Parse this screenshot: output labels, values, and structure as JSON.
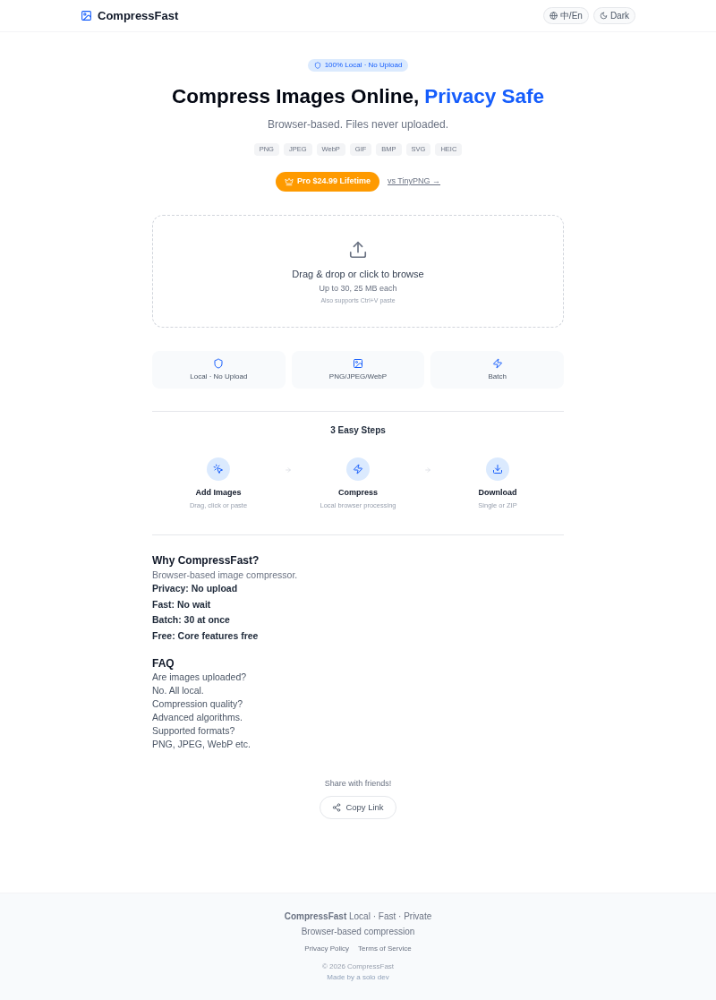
{
  "header": {
    "logo_text": "CompressFast",
    "buttons": [
      {
        "kind": "language",
        "label": "中/En"
      },
      {
        "kind": "theme",
        "label": "Dark"
      }
    ]
  },
  "hero": {
    "badge": "100% Local · No Upload",
    "title": "Compress Images Online,",
    "title_highlight": "Privacy Safe",
    "subtitle": "Browser-based. Files never uploaded.",
    "formats": [
      "PNG",
      "JPEG",
      "WebP",
      "GIF",
      "BMP",
      "SVG",
      "HEIC"
    ],
    "pro_button": "Pro $24.99 Lifetime",
    "compare_link": "vs TinyPNG →"
  },
  "dropzone": {
    "title": "Drag & drop or click to browse",
    "limit": "Up to 30, 25 MB each",
    "hint": "Also supports Ctrl+V paste"
  },
  "features": [
    {
      "kind": "privacy",
      "label": "Local · No Upload"
    },
    {
      "kind": "formats",
      "label": "PNG/JPEG/WebP"
    },
    {
      "kind": "batch",
      "label": "Batch"
    }
  ],
  "steps": {
    "title": "3 Easy Steps",
    "items": [
      {
        "kind": "add",
        "title": "Add Images",
        "description": "Drag, click or paste"
      },
      {
        "kind": "compress",
        "title": "Compress",
        "description": "Local browser processing"
      },
      {
        "kind": "download",
        "title": "Download",
        "description": "Single or ZIP"
      }
    ]
  },
  "why": {
    "title": "Why CompressFast?",
    "intro": "Browser-based image compressor.",
    "points": [
      "Privacy: No upload",
      "Fast: No wait",
      "Batch: 30 at once",
      "Free: Core features free"
    ]
  },
  "faq": {
    "title": "FAQ",
    "items": [
      {
        "question": "Are images uploaded?",
        "answer": "No. All local."
      },
      {
        "question": "Compression quality?",
        "answer": "Advanced algorithms."
      },
      {
        "question": "Supported formats?",
        "answer": "PNG, JPEG, WebP etc."
      }
    ]
  },
  "share": {
    "prompt": "Share with friends!",
    "button": "Copy Link"
  },
  "footer": {
    "tagline": "**CompressFast** Local · Fast · Private",
    "description": "Browser-based compression",
    "links": [
      "Privacy Policy",
      "Terms of Service"
    ],
    "copyright": "© 2026 CompressFast",
    "credit": "Made by a solo dev"
  }
}
